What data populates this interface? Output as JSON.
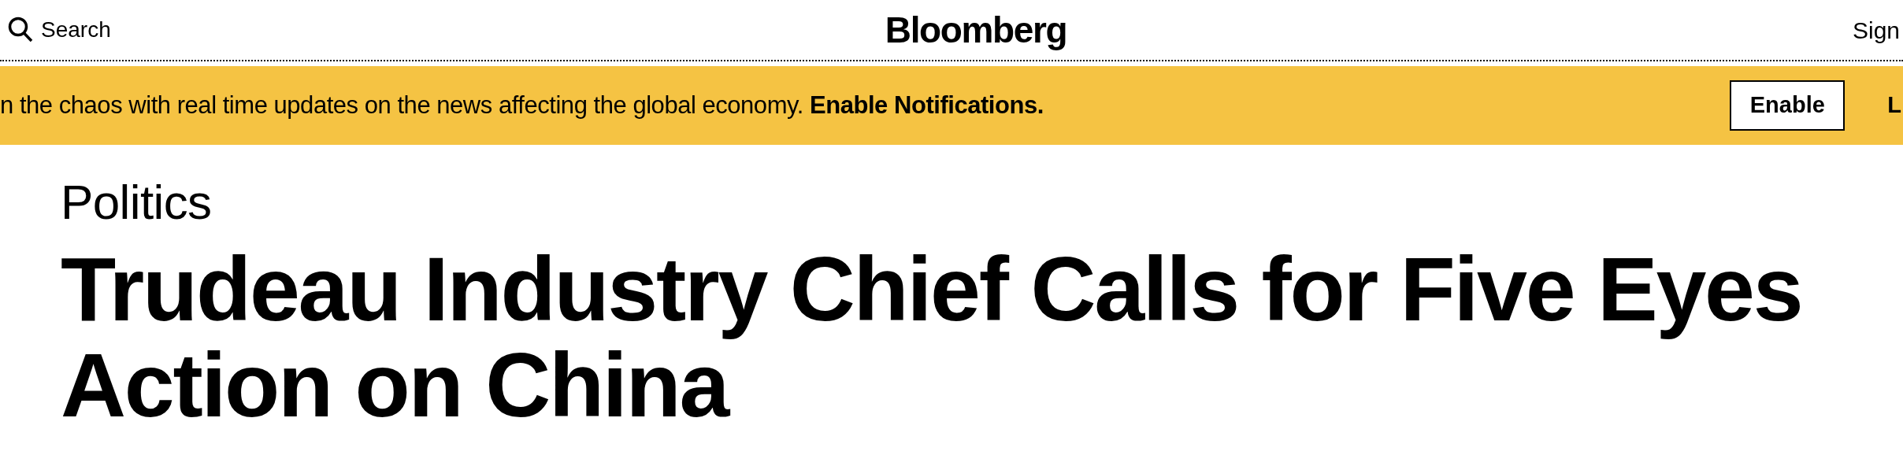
{
  "header": {
    "search_label": "Search",
    "logo": "Bloomberg",
    "sign_in": "Sign"
  },
  "banner": {
    "message": "n the chaos with real time updates on the news affecting the global economy. **Enable Notifications.**",
    "button": "Enable",
    "trailing": "L"
  },
  "article": {
    "section": "Politics",
    "headline": "Trudeau Industry Chief Calls for Five Eyes Action on China"
  }
}
